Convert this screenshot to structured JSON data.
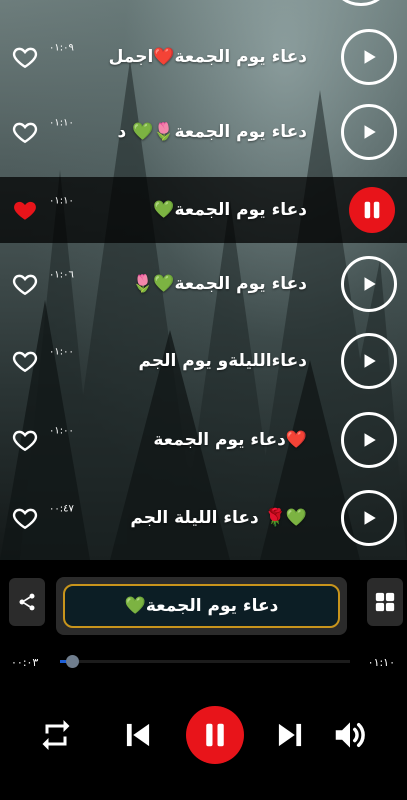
{
  "playlist": [
    {
      "title": "دعاء يوم الجمعة❤️اجمل",
      "duration": "٠١:٠٩",
      "favorite": false,
      "playing": false
    },
    {
      "title": "دعاء يوم الجمعة🌷💚 د",
      "duration": "٠١:١٠",
      "favorite": false,
      "playing": false
    },
    {
      "title": "دعاء يوم الجمعة💚",
      "duration": "٠١:١٠",
      "favorite": true,
      "playing": true
    },
    {
      "title": "دعاء يوم الجمعة💚🌷",
      "duration": "٠١:٠٦",
      "favorite": false,
      "playing": false
    },
    {
      "title": "دعاءالليلةو يوم الجم",
      "duration": "٠١:٠٠",
      "favorite": false,
      "playing": false
    },
    {
      "title": "❤️دعاء يوم الجمعة",
      "duration": "٠١:٠٠",
      "favorite": false,
      "playing": false
    },
    {
      "title": "💚🌹 دعاء الليلة الجم",
      "duration": "٠٠:٤٧",
      "favorite": false,
      "playing": false
    }
  ],
  "player": {
    "now_playing": "دعاء يوم الجمعة💚",
    "elapsed": "٠٠:٠٣",
    "total": "٠١:١٠",
    "progress": 0.04
  },
  "colors": {
    "accent_red": "#e8141a",
    "progress_blue": "#1d5fd8",
    "title_box_border": "#c8941c"
  },
  "icons": {
    "favorite": "heart-icon",
    "play": "play-icon",
    "pause": "pause-icon",
    "share": "share-icon",
    "grid": "grid-icon",
    "repeat": "repeat-icon",
    "previous": "skip-previous-icon",
    "next": "skip-next-icon",
    "volume": "volume-icon"
  }
}
